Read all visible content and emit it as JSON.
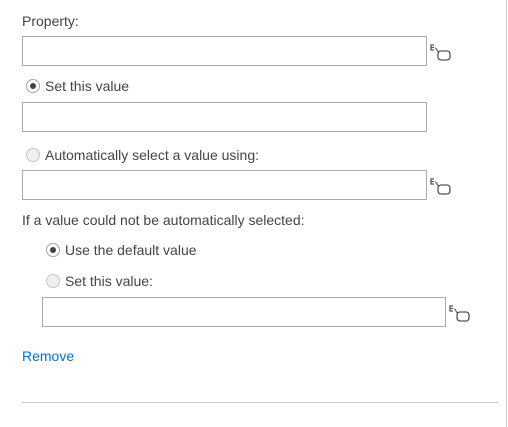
{
  "property": {
    "label": "Property:",
    "value": ""
  },
  "set_value_option": {
    "label": "Set this value",
    "checked": true,
    "value": ""
  },
  "auto_select_option": {
    "label": "Automatically select a value using:",
    "checked": false,
    "value": ""
  },
  "fallback": {
    "heading": "If a value could not be automatically selected:",
    "use_default_label": "Use the default value",
    "use_default_checked": true,
    "set_value_label": "Set this value:",
    "set_value_checked": false,
    "set_value_value": ""
  },
  "actions": {
    "remove_label": "Remove"
  },
  "icons": {
    "formula": "formula-builder-icon"
  },
  "colors": {
    "link": "#0072c6",
    "text": "#444444",
    "border": "#ababab"
  }
}
